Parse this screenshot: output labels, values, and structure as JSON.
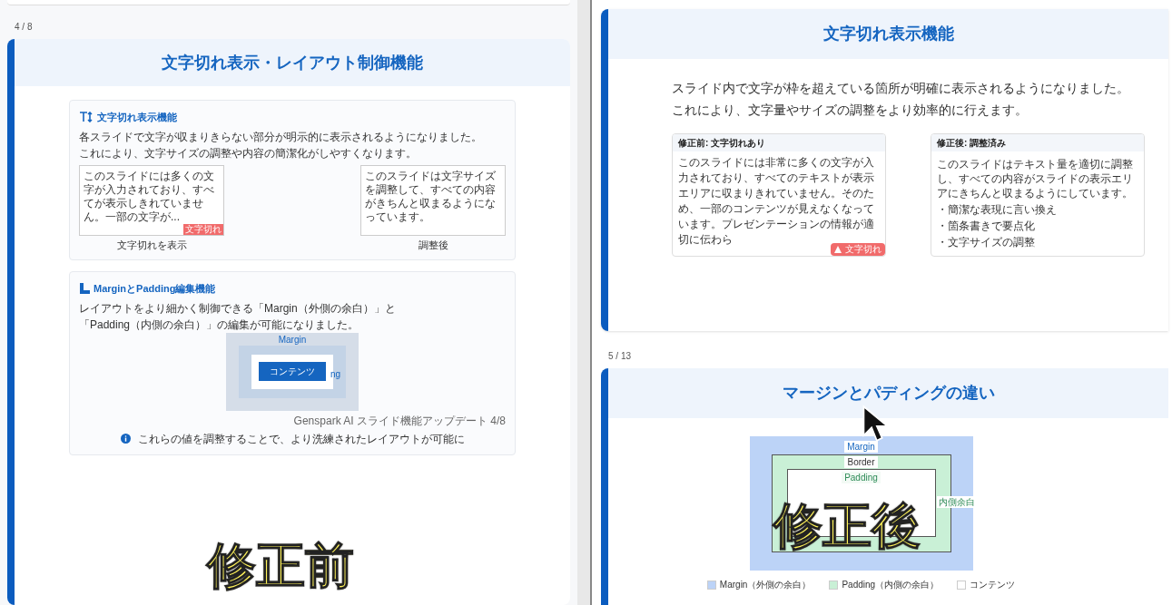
{
  "left_pane": {
    "page_number": "4 / 8",
    "title": "文字切れ表示・レイアウト制御機能",
    "sections": [
      {
        "kind": "truncation",
        "heading": "文字切れ表示機能",
        "paragraphs": [
          "各スライドで文字が収まりきらない部分が明示的に表示されるようになりました。",
          "これにより、文字サイズの調整や内容の簡潔化がしやすくなります。"
        ],
        "samples": [
          {
            "text": "このスライドには多くの文字が入力されており、すべてが表示しきれていません。一部の文字が...",
            "badge": "文字切れ",
            "caption": "文字切れを表示"
          },
          {
            "text": "このスライドは文字サイズを調整して、すべての内容がきちんと収まるようになっています。",
            "caption": "調整後"
          }
        ]
      },
      {
        "kind": "box_model",
        "heading": "MarginとPadding編集機能",
        "paragraphs": [
          "レイアウトをより細かく制御できる「Margin（外側の余白）」と",
          "「Padding（内側の余白）」の編集が可能になりました。"
        ],
        "margin_label": "Margin",
        "padding_label": "ng",
        "content_label": "コンテンツ",
        "footer": "Genspark AI スライド機能アップデート 4/8",
        "note": "これらの値を調整することで、より洗練されたレイアウトが可能に"
      }
    ],
    "caption": "修正前"
  },
  "right_pane": {
    "slide_1": {
      "title": "文字切れ表示機能",
      "paragraphs": [
        "スライド内で文字が枠を超えている箇所が明確に表示されるようになりました。",
        "これにより、文字量やサイズの調整をより効率的に行えます。"
      ],
      "cards": [
        {
          "header": "修正前: 文字切れあり",
          "text": "このスライドには非常に多くの文字が入力されており、すべてのテキストが表示エリアに収まりきれていません。そのため、一部のコンテンツが見えなくなっています。プレゼンテーションの情報が適切に伝わら",
          "badge": "文字切れ"
        },
        {
          "header": "修正後: 調整済み",
          "text": "このスライドはテキスト量を適切に調整し、すべての内容がスライドの表示エリアにきちんと収まるようにしています。",
          "bullets": [
            "・簡潔な表現に言い換え",
            "・箇条書きで要点化",
            "・文字サイズの調整"
          ]
        }
      ]
    },
    "slide_2": {
      "page_number": "5 / 13",
      "title": "マージンとパディングの違い",
      "margin_label": "Margin",
      "border_label": "Border",
      "padding_label": "Padding",
      "side_label": "内側余白",
      "legend": [
        {
          "label": "Margin（外側の余白）",
          "color": "#bcd3f7"
        },
        {
          "label": "Padding（内側の余白）",
          "color": "#c9f0d6"
        },
        {
          "label": "コンテンツ",
          "color": "#ffffff"
        }
      ]
    },
    "caption": "修正後"
  }
}
